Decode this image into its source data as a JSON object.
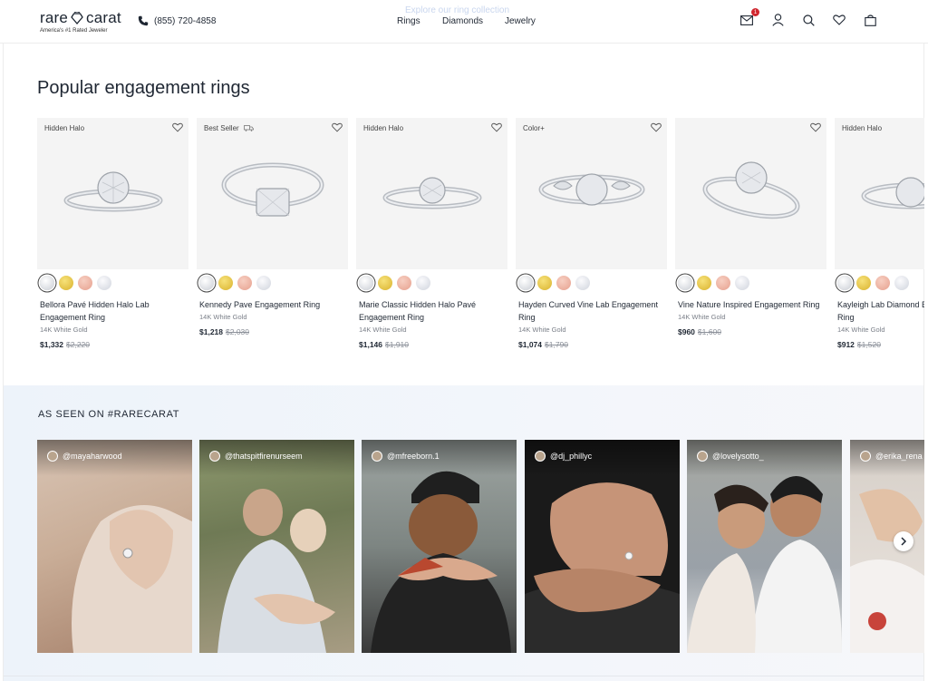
{
  "header": {
    "logo_text": "rare",
    "logo_text2": "carat",
    "logo_tagline": "America's #1 Rated Jeweler",
    "phone": "(855) 720-4858",
    "promo": "Explore our ring collection",
    "nav": [
      "Rings",
      "Diamonds",
      "Jewelry"
    ],
    "notification_count": "1"
  },
  "rings_section": {
    "title": "Popular engagement rings",
    "cards": [
      {
        "tag": "Hidden Halo",
        "name": "Bellora Pavé Hidden Halo Lab Engagement Ring",
        "metal": "14K White Gold",
        "price": "$1,332",
        "old_price": "$2,220"
      },
      {
        "tag": "Best Seller",
        "name": "Kennedy Pave Engagement Ring",
        "metal": "14K White Gold",
        "price": "$1,218",
        "old_price": "$2,030"
      },
      {
        "tag": "Hidden Halo",
        "name": "Marie Classic Hidden Halo Pavé Engagement Ring",
        "metal": "14K White Gold",
        "price": "$1,146",
        "old_price": "$1,910"
      },
      {
        "tag": "Color+",
        "name": "Hayden Curved Vine Lab Engagement Ring",
        "metal": "14K White Gold",
        "price": "$1,074",
        "old_price": "$1,790"
      },
      {
        "tag": "",
        "name": "Vine Nature Inspired Engagement Ring",
        "metal": "14K White Gold",
        "price": "$960",
        "old_price": "$1,600"
      },
      {
        "tag": "Hidden Halo",
        "name": "Kayleigh Lab Diamond Engagement Ring",
        "metal": "14K White Gold",
        "price": "$912",
        "old_price": "$1,520"
      }
    ]
  },
  "social_section": {
    "title": "AS SEEN ON #RARECARAT",
    "posts": [
      {
        "handle": "@mayaharwood"
      },
      {
        "handle": "@thatspitfirenurseem"
      },
      {
        "handle": "@mfreeborn.1"
      },
      {
        "handle": "@dj_phillyc"
      },
      {
        "handle": "@lovelysotto_"
      },
      {
        "handle": "@erika_rena"
      }
    ]
  },
  "colors": {
    "text": "#1f2733",
    "badge": "#d0262f",
    "social_bg": "#edf3fa"
  },
  "icons": [
    "phone-icon",
    "mail-icon",
    "user-icon",
    "search-icon",
    "heart-icon",
    "bag-icon",
    "chevron-right-icon"
  ]
}
